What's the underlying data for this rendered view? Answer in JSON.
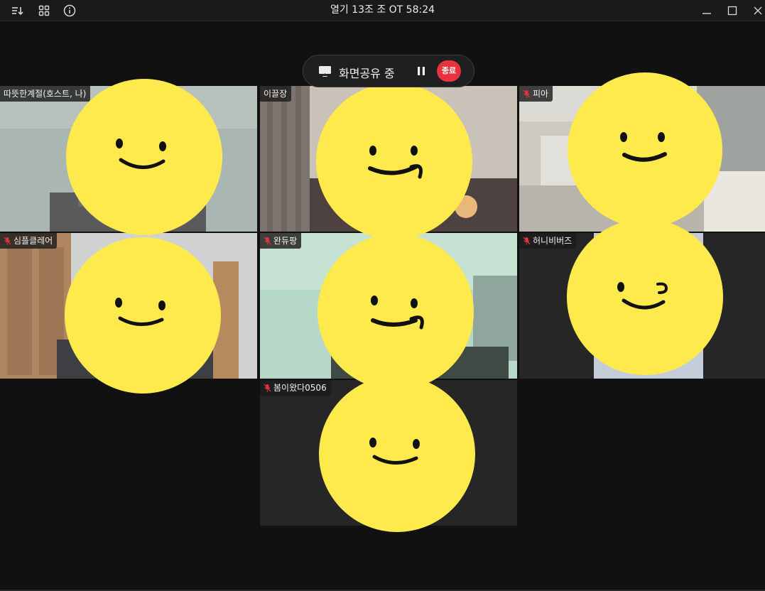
{
  "window": {
    "title": "열기 13조 조 OT 58:24"
  },
  "toolbar": {
    "icons": [
      "sort-icon",
      "grid-view-icon",
      "info-icon"
    ]
  },
  "share": {
    "status_label": "화면공유 중",
    "end_label": "종료"
  },
  "participants": [
    {
      "name": "따뜻한계절(호스트, 나)",
      "muted": false
    },
    {
      "name": "이끌장",
      "muted": false
    },
    {
      "name": "피아",
      "muted": true
    },
    {
      "name": "심플클레어",
      "muted": true
    },
    {
      "name": "완듀팡",
      "muted": true
    },
    {
      "name": "허니비버즈",
      "muted": true
    },
    {
      "name": "봄이왔다0506",
      "muted": true
    }
  ],
  "colors": {
    "accent_end": "#e8333e",
    "sticker": "#ffea4d",
    "muted_mic": "#e8333e"
  }
}
